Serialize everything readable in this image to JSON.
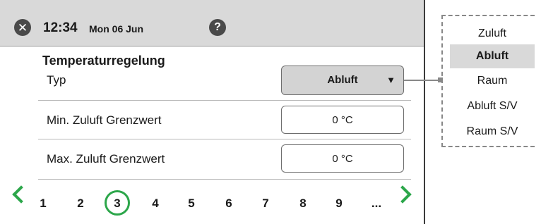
{
  "header": {
    "time": "12:34",
    "date": "Mon 06 Jun",
    "close_icon": "close-icon",
    "help_icon": "help-icon",
    "close_symbol": "✕",
    "help_symbol": "?"
  },
  "section": {
    "title": "Temperaturregelung"
  },
  "rows": [
    {
      "label": "Typ",
      "value": "Abluft",
      "control": "select",
      "arrow": "▼"
    },
    {
      "label": "Min. Zuluft Grenzwert",
      "value": "0 °C",
      "control": "field"
    },
    {
      "label": "Max. Zuluft Grenzwert",
      "value": "0 °C",
      "control": "field"
    }
  ],
  "pagination": {
    "pages": [
      "1",
      "2",
      "3",
      "4",
      "5",
      "6",
      "7",
      "8",
      "9",
      "..."
    ],
    "current_page": "3",
    "prev_icon": "chevron-left-icon",
    "next_icon": "chevron-right-icon"
  },
  "dropdown": {
    "options": [
      "Zuluft",
      "Abluft",
      "Raum",
      "Abluft S/V",
      "Raum S/V"
    ],
    "selected": "Abluft"
  },
  "colors": {
    "accent": "#2ca64a",
    "header_bg": "#d9d9d9",
    "selected_bg": "#d9d9d9",
    "icon_bg": "#4a4a4a"
  }
}
